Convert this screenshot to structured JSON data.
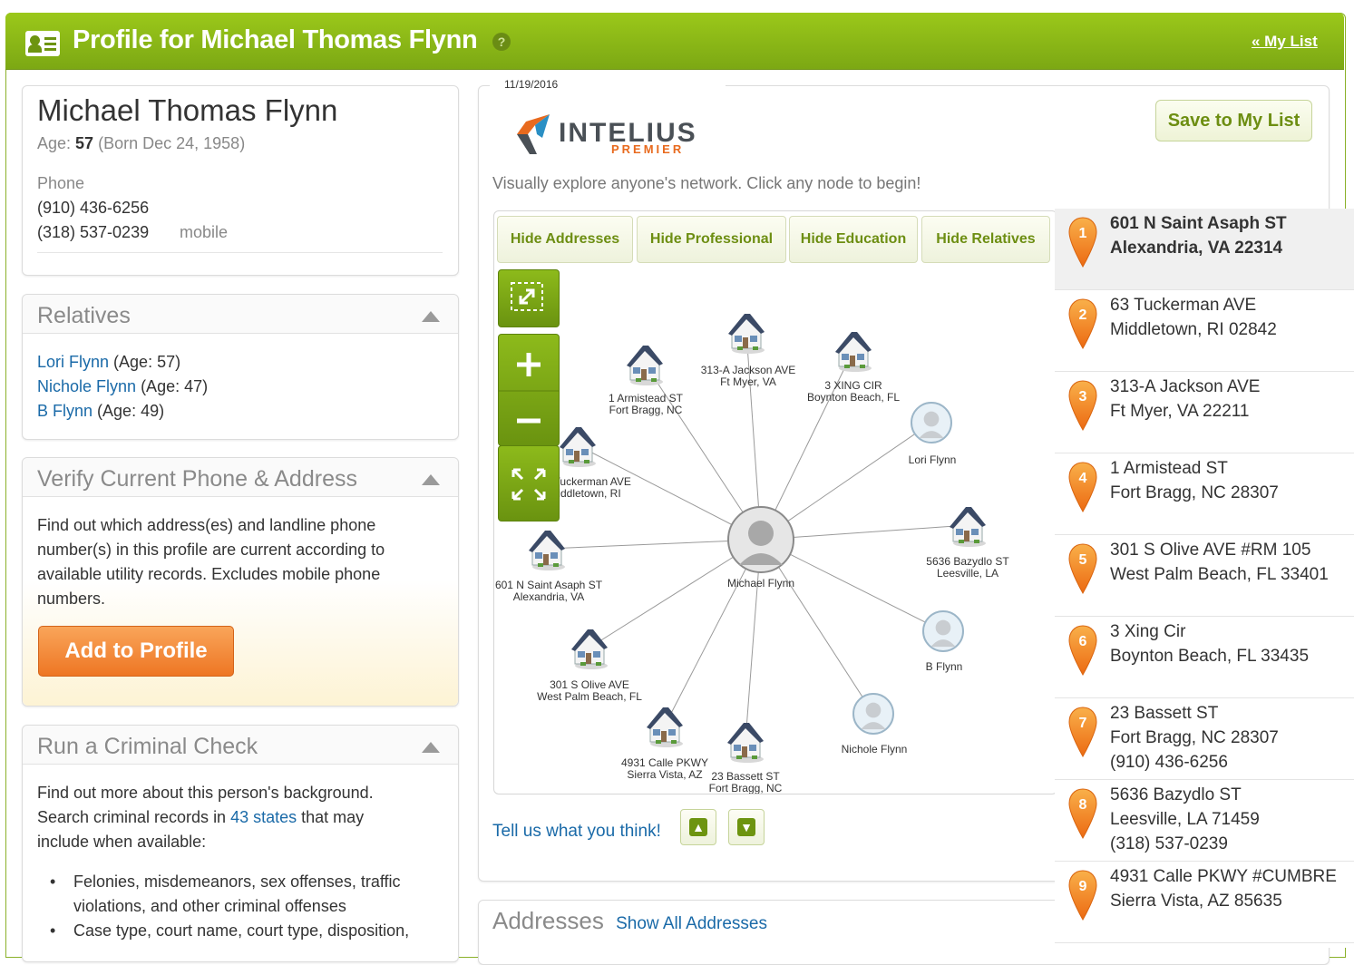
{
  "header": {
    "title": "Profile for Michael Thomas Flynn",
    "help_icon": "?",
    "my_list_link": "« My List"
  },
  "profile": {
    "name": "Michael Thomas Flynn",
    "age_label": "Age:",
    "age": "57",
    "born": "(Born Dec 24, 1958)",
    "phone_label": "Phone",
    "phones": [
      "(910) 436-6256",
      "(318) 537-0239"
    ],
    "phone2_type": "mobile"
  },
  "relatives": {
    "title": "Relatives",
    "items": [
      {
        "name": "Lori Flynn",
        "age": "(Age: 57)"
      },
      {
        "name": "Nichole Flynn",
        "age": "(Age: 47)"
      },
      {
        "name": "B Flynn",
        "age": "(Age: 49)"
      }
    ]
  },
  "verify": {
    "title": "Verify Current Phone & Address",
    "lines": [
      "Find out which address(es) and landline phone",
      "number(s) in this profile are current according to",
      "available utility records. Excludes mobile phone",
      "numbers."
    ],
    "button": "Add to Profile"
  },
  "criminal": {
    "title": "Run a Criminal Check",
    "line1": "Find out more about this person's background.",
    "line2_pre": "Search criminal records in",
    "line2_link": "43 states",
    "line2_post": "that may",
    "line3": "include when available:",
    "bullets": [
      [
        "Felonies, misdemeanors, sex offenses, traffic",
        "violations, and other criminal offenses"
      ],
      [
        "Case type, court name, court type, disposition,"
      ]
    ]
  },
  "report": {
    "date": "11/19/2016",
    "logo_main": "INTELIUS",
    "logo_sub": "PREMIER",
    "save_button": "Save to My List",
    "tagline": "Visually explore anyone's network. Click any node to begin!",
    "tabs": [
      "Hide Addresses",
      "Hide Professional",
      "Hide Education",
      "Hide Relatives"
    ],
    "feedback": "Tell us what you think!",
    "addresses_title": "Addresses",
    "show_all": "Show All Addresses"
  },
  "graph": {
    "center": "Michael Flynn",
    "nodes": [
      {
        "type": "house",
        "l1": "313-A Jackson AVE",
        "l2": "Ft Myer, VA"
      },
      {
        "type": "house",
        "l1": "1 Armistead ST",
        "l2": "Fort Bragg, NC"
      },
      {
        "type": "house",
        "l1": "3 XING CIR",
        "l2": "Boynton Beach, FL"
      },
      {
        "type": "person",
        "l1": "Lori Flynn",
        "l2": ""
      },
      {
        "type": "house",
        "l1": "63 Tuckerman AVE",
        "l2": "Middletown, RI"
      },
      {
        "type": "house",
        "l1": "5636 Bazydlo ST",
        "l2": "Leesville, LA"
      },
      {
        "type": "house",
        "l1": "601 N Saint Asaph ST",
        "l2": "Alexandria, VA"
      },
      {
        "type": "person",
        "l1": "B Flynn",
        "l2": ""
      },
      {
        "type": "house",
        "l1": "301 S Olive AVE",
        "l2": "West Palm Beach, FL"
      },
      {
        "type": "person",
        "l1": "Nichole Flynn",
        "l2": ""
      },
      {
        "type": "house",
        "l1": "4931 Calle PKWY",
        "l2": "Sierra Vista, AZ"
      },
      {
        "type": "house",
        "l1": "23 Bassett ST",
        "l2": "Fort Bragg, NC"
      }
    ]
  },
  "address_list": [
    {
      "n": "1",
      "l1": "601 N Saint Asaph ST",
      "l2": "Alexandria, VA 22314",
      "l3": ""
    },
    {
      "n": "2",
      "l1": "63 Tuckerman AVE",
      "l2": "Middletown, RI 02842",
      "l3": ""
    },
    {
      "n": "3",
      "l1": "313-A Jackson AVE",
      "l2": "Ft Myer, VA 22211",
      "l3": ""
    },
    {
      "n": "4",
      "l1": "1 Armistead ST",
      "l2": "Fort Bragg, NC 28307",
      "l3": ""
    },
    {
      "n": "5",
      "l1": "301 S Olive AVE #RM 105",
      "l2": "West Palm Beach, FL 33401",
      "l3": ""
    },
    {
      "n": "6",
      "l1": "3 Xing Cir",
      "l2": "Boynton Beach, FL 33435",
      "l3": ""
    },
    {
      "n": "7",
      "l1": "23 Bassett ST",
      "l2": "Fort Bragg, NC 28307",
      "l3": "(910) 436-6256"
    },
    {
      "n": "8",
      "l1": "5636 Bazydlo ST",
      "l2": "Leesville, LA 71459",
      "l3": "(318) 537-0239"
    },
    {
      "n": "9",
      "l1": "4931 Calle PKWY #CUMBRE",
      "l2": "Sierra Vista, AZ 85635",
      "l3": ""
    }
  ],
  "colors": {
    "brand_green": "#8bb31a",
    "accent_orange": "#ee7623",
    "link_blue": "#1a6aa8"
  }
}
